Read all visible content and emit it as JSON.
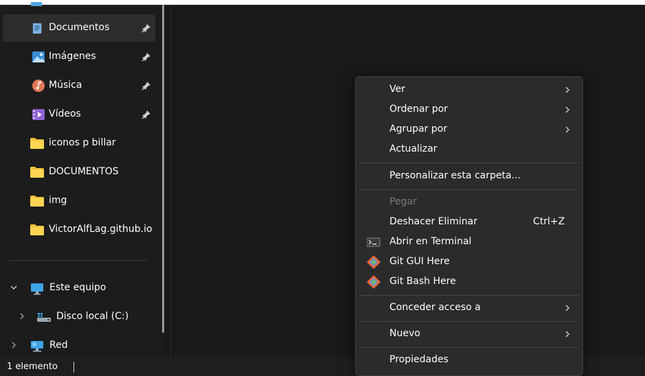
{
  "sidebar": {
    "quick_access": [
      {
        "label": "Documentos",
        "icon": "documents-folder-icon",
        "pinned": true,
        "selected": true
      },
      {
        "label": "Imágenes",
        "icon": "pictures-folder-icon",
        "pinned": true
      },
      {
        "label": "Música",
        "icon": "music-folder-icon",
        "pinned": true
      },
      {
        "label": "Vídeos",
        "icon": "videos-folder-icon",
        "pinned": true
      },
      {
        "label": "iconos p billar",
        "icon": "folder-icon"
      },
      {
        "label": "DOCUMENTOS",
        "icon": "folder-icon"
      },
      {
        "label": "img",
        "icon": "folder-icon"
      },
      {
        "label": "VictorAlfLag.github.io",
        "icon": "folder-icon"
      }
    ],
    "tree": [
      {
        "label": "Este equipo",
        "icon": "this-pc-icon",
        "expanded": true
      },
      {
        "label": "Disco local (C:)",
        "icon": "local-disk-icon",
        "expanded": false
      },
      {
        "label": "Red",
        "icon": "network-icon",
        "expanded": false
      }
    ]
  },
  "status_bar": {
    "text": "1 elemento"
  },
  "context_menu": {
    "items": [
      {
        "label": "Ver",
        "submenu": true
      },
      {
        "label": "Ordenar por",
        "submenu": true
      },
      {
        "label": "Agrupar por",
        "submenu": true
      },
      {
        "label": "Actualizar"
      },
      {
        "label": "Personalizar esta carpeta..."
      },
      {
        "label": "Pegar",
        "disabled": true
      },
      {
        "label": "Deshacer Eliminar",
        "shortcut": "Ctrl+Z"
      },
      {
        "label": "Abrir en Terminal",
        "icon": "terminal-icon"
      },
      {
        "label": "Git GUI Here",
        "icon": "git-icon"
      },
      {
        "label": "Git Bash Here",
        "icon": "git-icon"
      },
      {
        "label": "Conceder acceso a",
        "submenu": true
      },
      {
        "label": "Nuevo",
        "submenu": true
      },
      {
        "label": "Propiedades"
      }
    ]
  },
  "colors": {
    "window_bg": "#191919",
    "sidebar_bg": "#1c1c1c",
    "menu_bg": "#2b2b2b",
    "folder_yellow": "#f4c23d",
    "disabled_text": "#7a7a7a"
  }
}
